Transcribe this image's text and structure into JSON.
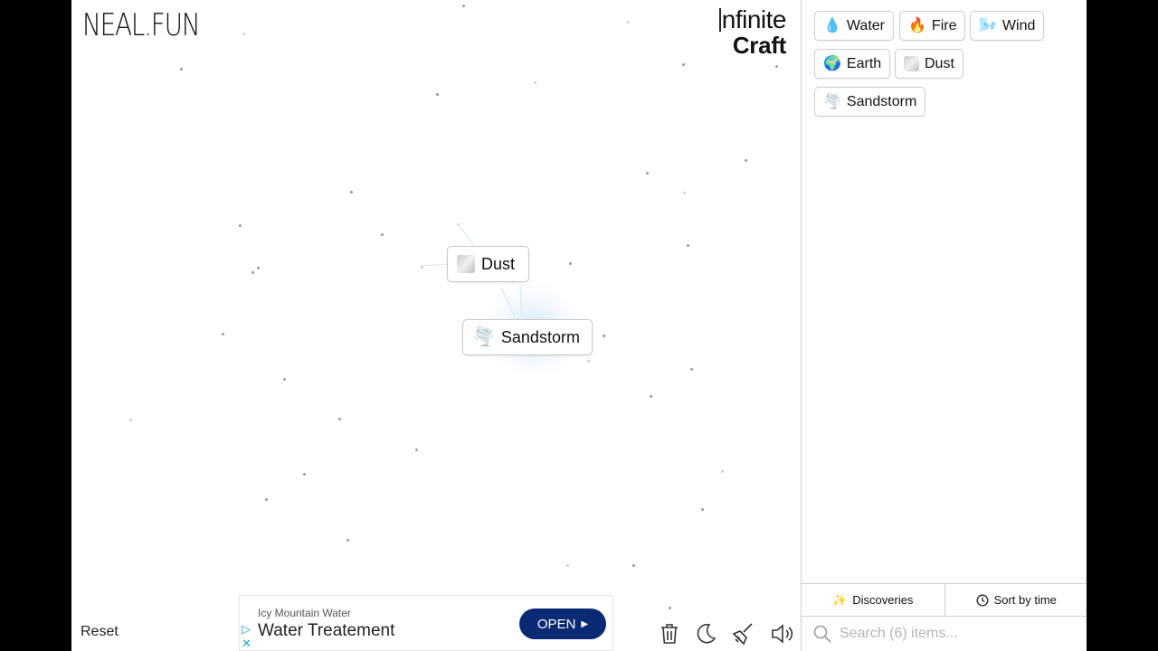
{
  "brand": {
    "logo": "NEAL.FUN",
    "title_line1": "nfinite",
    "title_line2": "Craft"
  },
  "canvas_items": [
    {
      "name": "Dust",
      "emoji": ""
    },
    {
      "name": "Sandstorm",
      "emoji": "🌪️"
    }
  ],
  "reset_label": "Reset",
  "ad": {
    "advertiser": "Icy Mountain Water",
    "headline": "Water Treatement",
    "cta": "OPEN"
  },
  "tools": {
    "trash_icon": "trash-icon",
    "dark_mode_icon": "moon-icon",
    "clear_icon": "broom-icon",
    "sound_icon": "speaker-icon"
  },
  "sidebar": {
    "items": [
      {
        "name": "Water",
        "emoji": "💧"
      },
      {
        "name": "Fire",
        "emoji": "🔥"
      },
      {
        "name": "Wind",
        "emoji": "🌬️"
      },
      {
        "name": "Earth",
        "emoji": "🌍"
      },
      {
        "name": "Dust",
        "emoji": ""
      },
      {
        "name": "Sandstorm",
        "emoji": "🌪️"
      }
    ],
    "discoveries_label": "Discoveries",
    "sort_label": "Sort by time",
    "search_placeholder": "Search (6) items..."
  }
}
